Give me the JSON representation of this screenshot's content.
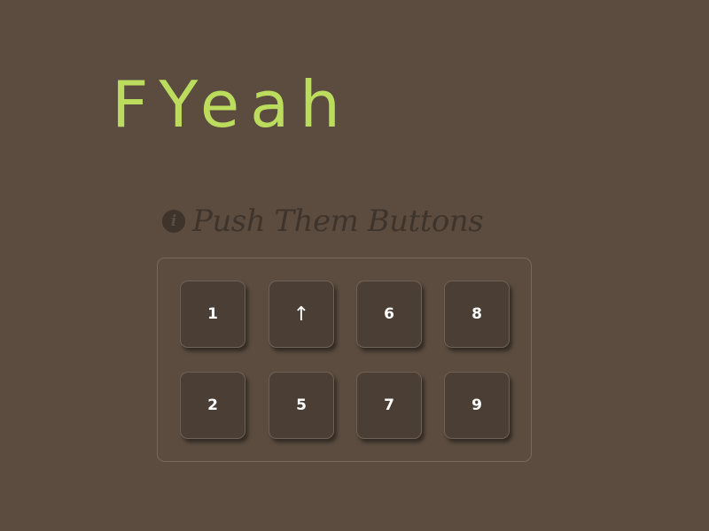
{
  "header": {
    "title": "FYeah"
  },
  "section": {
    "info_icon_glyph": "i",
    "info_icon": "info-icon",
    "title": "Push Them Buttons"
  },
  "buttons": {
    "row1": [
      "1",
      "↑",
      "6",
      "8"
    ],
    "row2": [
      "2",
      "5",
      "7",
      "9"
    ]
  },
  "colors": {
    "background": "#5b4c3f",
    "title": "#bcdc5e",
    "button_face": "#4b3e34",
    "button_text": "#ffffff",
    "section_text": "#3f342b"
  }
}
